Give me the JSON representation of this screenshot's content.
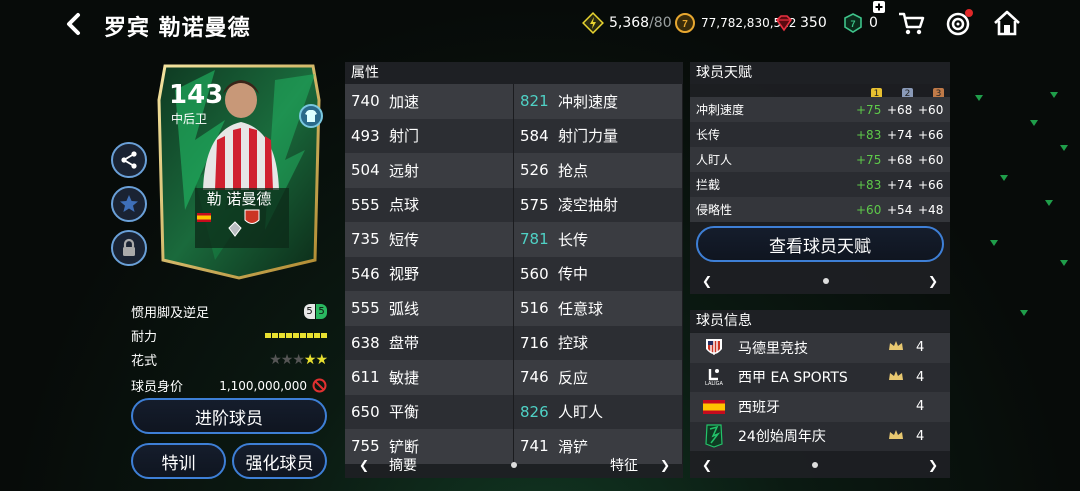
{
  "header": {
    "title": "罗宾 勒诺曼德",
    "stamina": "5,368",
    "stamina_max": "/80",
    "coins": "77,782,830,512",
    "gems": "350",
    "tokens": "0"
  },
  "card": {
    "rating": "143",
    "position": "中后卫",
    "name": "勒 诺曼德"
  },
  "left_stats": {
    "foot_label": "惯用脚及逆足",
    "foot_primary": "5",
    "foot_weak": "5",
    "stamina_label": "耐力",
    "skill_label": "花式",
    "skill_stars_filled": 2,
    "skill_stars_total": 5,
    "value_label": "球员身价",
    "value": "1,100,000,000"
  },
  "buttons": {
    "advance": "进阶球员",
    "training": "特训",
    "enhance": "强化球员",
    "view_talent": "查看球员天赋"
  },
  "attributes": {
    "heading": "属性",
    "rows": [
      {
        "v1": "740",
        "n1": "加速",
        "v2": "821",
        "n2": "冲刺速度",
        "h2": true
      },
      {
        "v1": "493",
        "n1": "射门",
        "v2": "584",
        "n2": "射门力量",
        "h2": false
      },
      {
        "v1": "504",
        "n1": "远射",
        "v2": "526",
        "n2": "抢点",
        "h2": false
      },
      {
        "v1": "555",
        "n1": "点球",
        "v2": "575",
        "n2": "凌空抽射",
        "h2": false
      },
      {
        "v1": "735",
        "n1": "短传",
        "v2": "781",
        "n2": "长传",
        "h2": true
      },
      {
        "v1": "546",
        "n1": "视野",
        "v2": "560",
        "n2": "传中",
        "h2": false
      },
      {
        "v1": "555",
        "n1": "弧线",
        "v2": "516",
        "n2": "任意球",
        "h2": false
      },
      {
        "v1": "638",
        "n1": "盘带",
        "v2": "716",
        "n2": "控球",
        "h2": false
      },
      {
        "v1": "611",
        "n1": "敏捷",
        "v2": "746",
        "n2": "反应",
        "h2": false
      },
      {
        "v1": "650",
        "n1": "平衡",
        "v2": "826",
        "n2": "人盯人",
        "h2": true
      },
      {
        "v1": "755",
        "n1": "铲断",
        "v2": "741",
        "n2": "滑铲",
        "h2": false
      }
    ],
    "pager_left": "摘要",
    "pager_right": "特征"
  },
  "talent": {
    "heading": "球员天赋",
    "tiers": [
      "1",
      "2",
      "3"
    ],
    "rows": [
      {
        "name": "冲刺速度",
        "t1": "+75",
        "t2": "+68",
        "t3": "+60"
      },
      {
        "name": "长传",
        "t1": "+83",
        "t2": "+74",
        "t3": "+66"
      },
      {
        "name": "人盯人",
        "t1": "+75",
        "t2": "+68",
        "t3": "+60"
      },
      {
        "name": "拦截",
        "t1": "+83",
        "t2": "+74",
        "t3": "+66"
      },
      {
        "name": "侵略性",
        "t1": "+60",
        "t2": "+54",
        "t3": "+48"
      }
    ]
  },
  "info": {
    "heading": "球员信息",
    "rows": [
      {
        "label": "马德里竞技",
        "num": "4"
      },
      {
        "label": "西甲 EA SPORTS",
        "num": "4"
      },
      {
        "label": "西班牙",
        "num": "4"
      },
      {
        "label": "24创始周年庆",
        "num": "4"
      }
    ],
    "laliga_text": "LALIGA"
  },
  "colors": {
    "accent_blue": "#3e7fd6",
    "highlight_teal": "#4fd1c5",
    "talent_green": "#5ec94a",
    "card_green": "#1fae5a"
  }
}
